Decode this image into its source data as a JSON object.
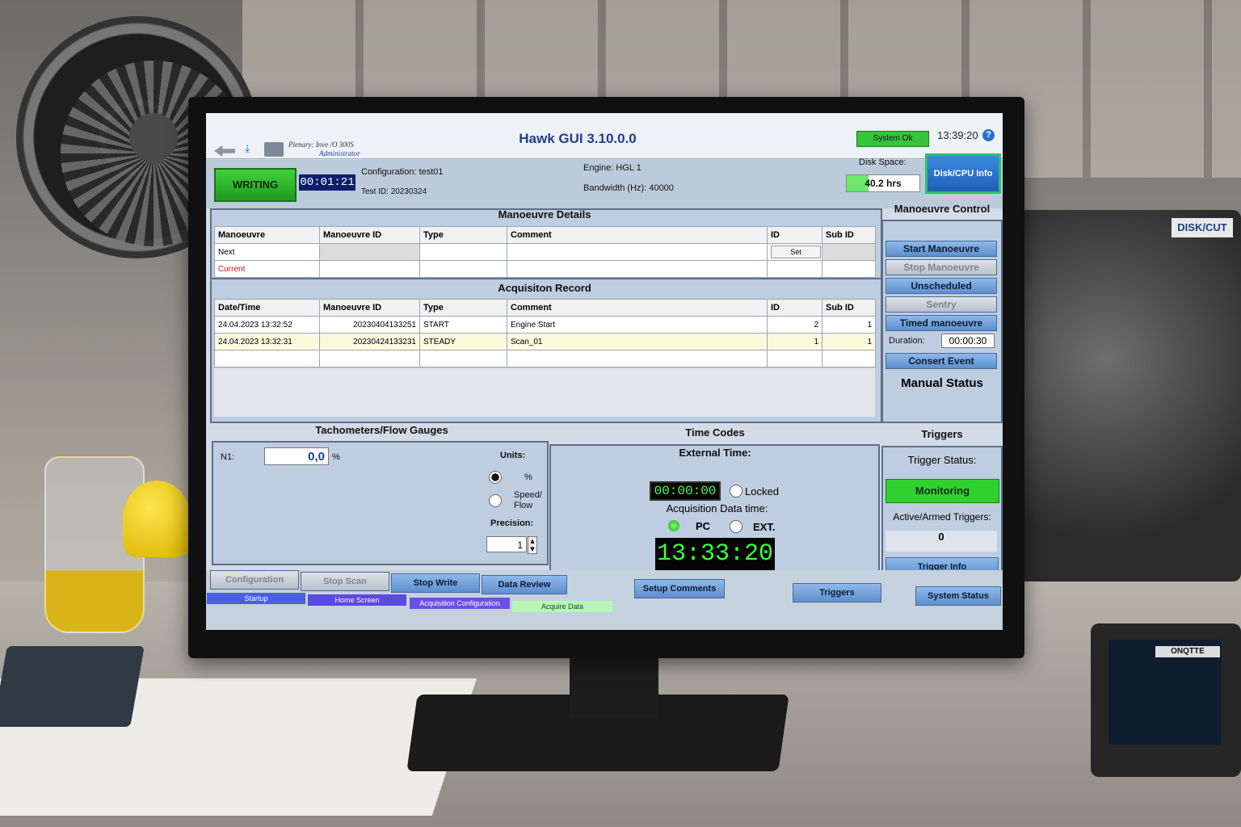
{
  "app": {
    "title": "Hawk GUI 3.10.0.0",
    "user_line1": "Plenary: Inve /O 300S",
    "user_line2": "Administrator",
    "system_status": "System Ok",
    "clock": "13:39:20",
    "help_glyph": "?"
  },
  "status": {
    "state": "WRITING",
    "elapsed": "00:01:21",
    "configuration_label": "Configuration:",
    "configuration_value": "test01",
    "test_id_label": "Test ID:",
    "test_id_value": "20230324",
    "engine_label": "Engine:",
    "engine_value": "HGL 1",
    "bandwidth_label": "Bandwidth (Hz):",
    "bandwidth_value": "40000",
    "disk_label": "Disk Space:",
    "disk_value": "40.2 hrs",
    "disk_fill": 0.3,
    "disk_button": "Disk/CPU Info"
  },
  "manoeuvre_details": {
    "title": "Manoeuvre Details",
    "columns": [
      "Manoeuvre",
      "Manoeuvre ID",
      "Type",
      "Comment",
      "ID",
      "Sub ID"
    ],
    "rows": [
      {
        "label": "Next",
        "set_button": "Set"
      },
      {
        "label": "Current"
      }
    ]
  },
  "acquisition_record": {
    "title": "Acquisiton Record",
    "columns": [
      "Date/Time",
      "Manoeuvre ID",
      "Type",
      "Comment",
      "ID",
      "Sub ID"
    ],
    "rows": [
      {
        "datetime": "24.04.2023 13:32:52",
        "man_id": "20230404133251",
        "type": "START",
        "comment": "Engine Start",
        "id": "2",
        "sub_id": "1"
      },
      {
        "datetime": "24.04.2023 13:32:31",
        "man_id": "20230424133231",
        "type": "STEADY",
        "comment": "Scan_01",
        "id": "1",
        "sub_id": "1"
      }
    ]
  },
  "manoeuvre_control": {
    "title": "Manoeuvre Control",
    "buttons": [
      "Start Manoeuvre",
      "Stop Manoeuvre",
      "Unscheduled",
      "Sentry",
      "Timed manoeuvre"
    ],
    "duration_label": "Duration:",
    "duration_value": "00:00:30",
    "insert_button": "Consert Event",
    "manual_status": "Manual Status"
  },
  "tachometers": {
    "title": "Tachometers/Flow Gauges",
    "n1_label": "N1:",
    "n1_value": "0,0",
    "n1_unit": "%",
    "units_label": "Units:",
    "unit_pct": "%",
    "unit_speed": "Speed/",
    "unit_flow": "Flow",
    "precision_label": "Precision:",
    "precision_value": "1"
  },
  "time_codes": {
    "title": "Time Codes",
    "external_label": "External Time:",
    "external_value": "00:00:00",
    "locked_label": "Locked",
    "acq_label": "Acquisition Data time:",
    "pc_label": "PC",
    "ext_label": "EXT.",
    "big_time": "13:33:20"
  },
  "triggers": {
    "title": "Triggers",
    "status_label": "Trigger Status:",
    "status_value": "Monitoring",
    "active_label": "Active/Armed Triggers:",
    "active_value": "0",
    "info_button": "Trigger Info"
  },
  "nav": {
    "buttons": [
      "Configuration",
      "Stop Scan",
      "Stop Write",
      "Data Review",
      "Setup Comments",
      "Triggers",
      "System Status"
    ],
    "tabs": [
      "Startup",
      "Home Screen",
      "Acquisition Configuration",
      "Acquire Data"
    ]
  },
  "colors": {
    "accent_blue": "#1f3f8f",
    "ok_green": "#2fd12f",
    "timecode_green": "#3dff3d"
  }
}
